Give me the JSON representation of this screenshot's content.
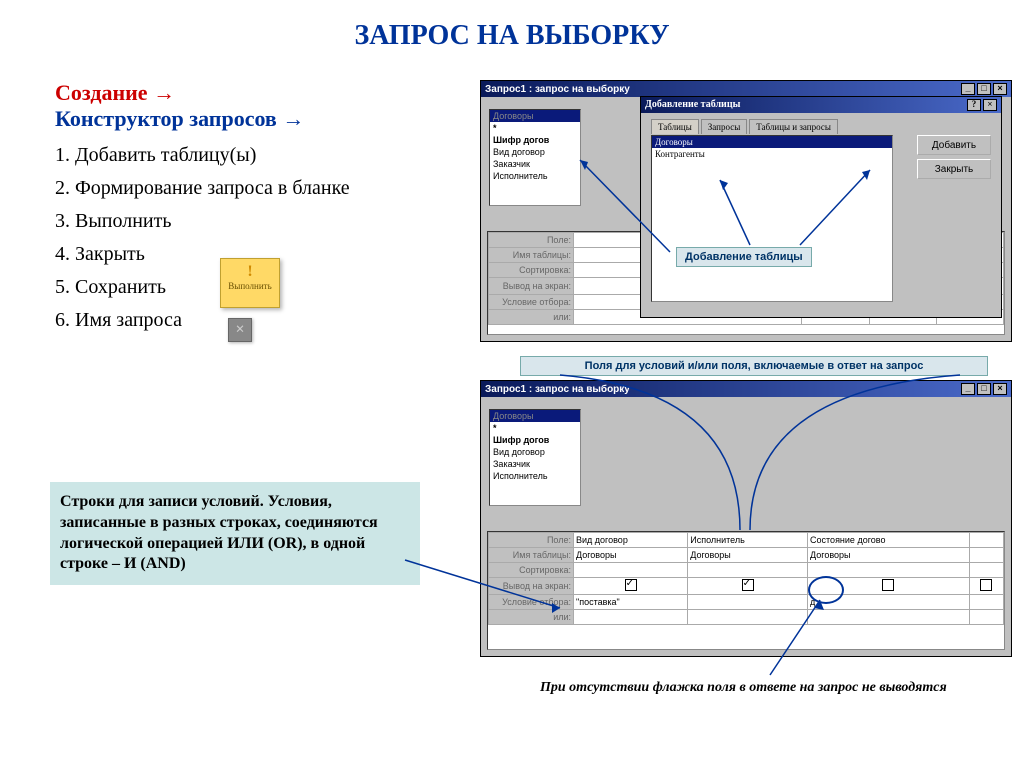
{
  "title": "ЗАПРОС НА ВЫБОРКУ",
  "create": {
    "red": "Создание",
    "blue": "Конструктор запросов"
  },
  "steps": {
    "s1": "1. Добавить таблицу(ы)",
    "s2": "2. Формирование запроса в бланке",
    "s3": "3. Выполнить",
    "s4": "4. Закрыть",
    "s5": "5. Сохранить",
    "s6": "6. Имя запроса"
  },
  "execute_label": "Выполнить",
  "info1": "Строки для записи условий. Условия, записанные в разных строках, соединяются  логической операцией ИЛИ (OR), в одной строке – И (AND)",
  "annot1": "Добавление таблицы",
  "annot2": "Поля для условий и/или поля, включаемые в ответ на запрос",
  "annot3": "При отсутствии флажка поля в ответе на запрос не выводятся",
  "win_title1": "Запрос1 : запрос на выборку",
  "win_title2": "Запрос1 : запрос на выборку",
  "dlg_title": "Добавление таблицы",
  "tabs": {
    "t1": "Таблицы",
    "t2": "Запросы",
    "t3": "Таблицы и запросы"
  },
  "btn_add": "Добавить",
  "btn_close": "Закрыть",
  "list": {
    "i1": "Договоры",
    "i2": "Контрагенты"
  },
  "tbl_box": {
    "title": "Договоры",
    "i0": "*",
    "i1": "Шифр догов",
    "i2": "Вид договор",
    "i3": "Заказчик",
    "i4": "Исполнитель"
  },
  "grid_labels": {
    "l1": "Поле:",
    "l2": "Имя таблицы:",
    "l3": "Сортировка:",
    "l4": "Вывод на экран:",
    "l5": "Условие отбора:",
    "l6": "или:"
  },
  "grid2": {
    "r1": {
      "c1": "Вид договор",
      "c2": "Исполнитель",
      "c3": "Состояние догово"
    },
    "r2": {
      "c1": "Договоры",
      "c2": "Договоры",
      "c3": "Договоры"
    },
    "r5": {
      "c1": "\"поставка\"",
      "c3": "д"
    }
  }
}
